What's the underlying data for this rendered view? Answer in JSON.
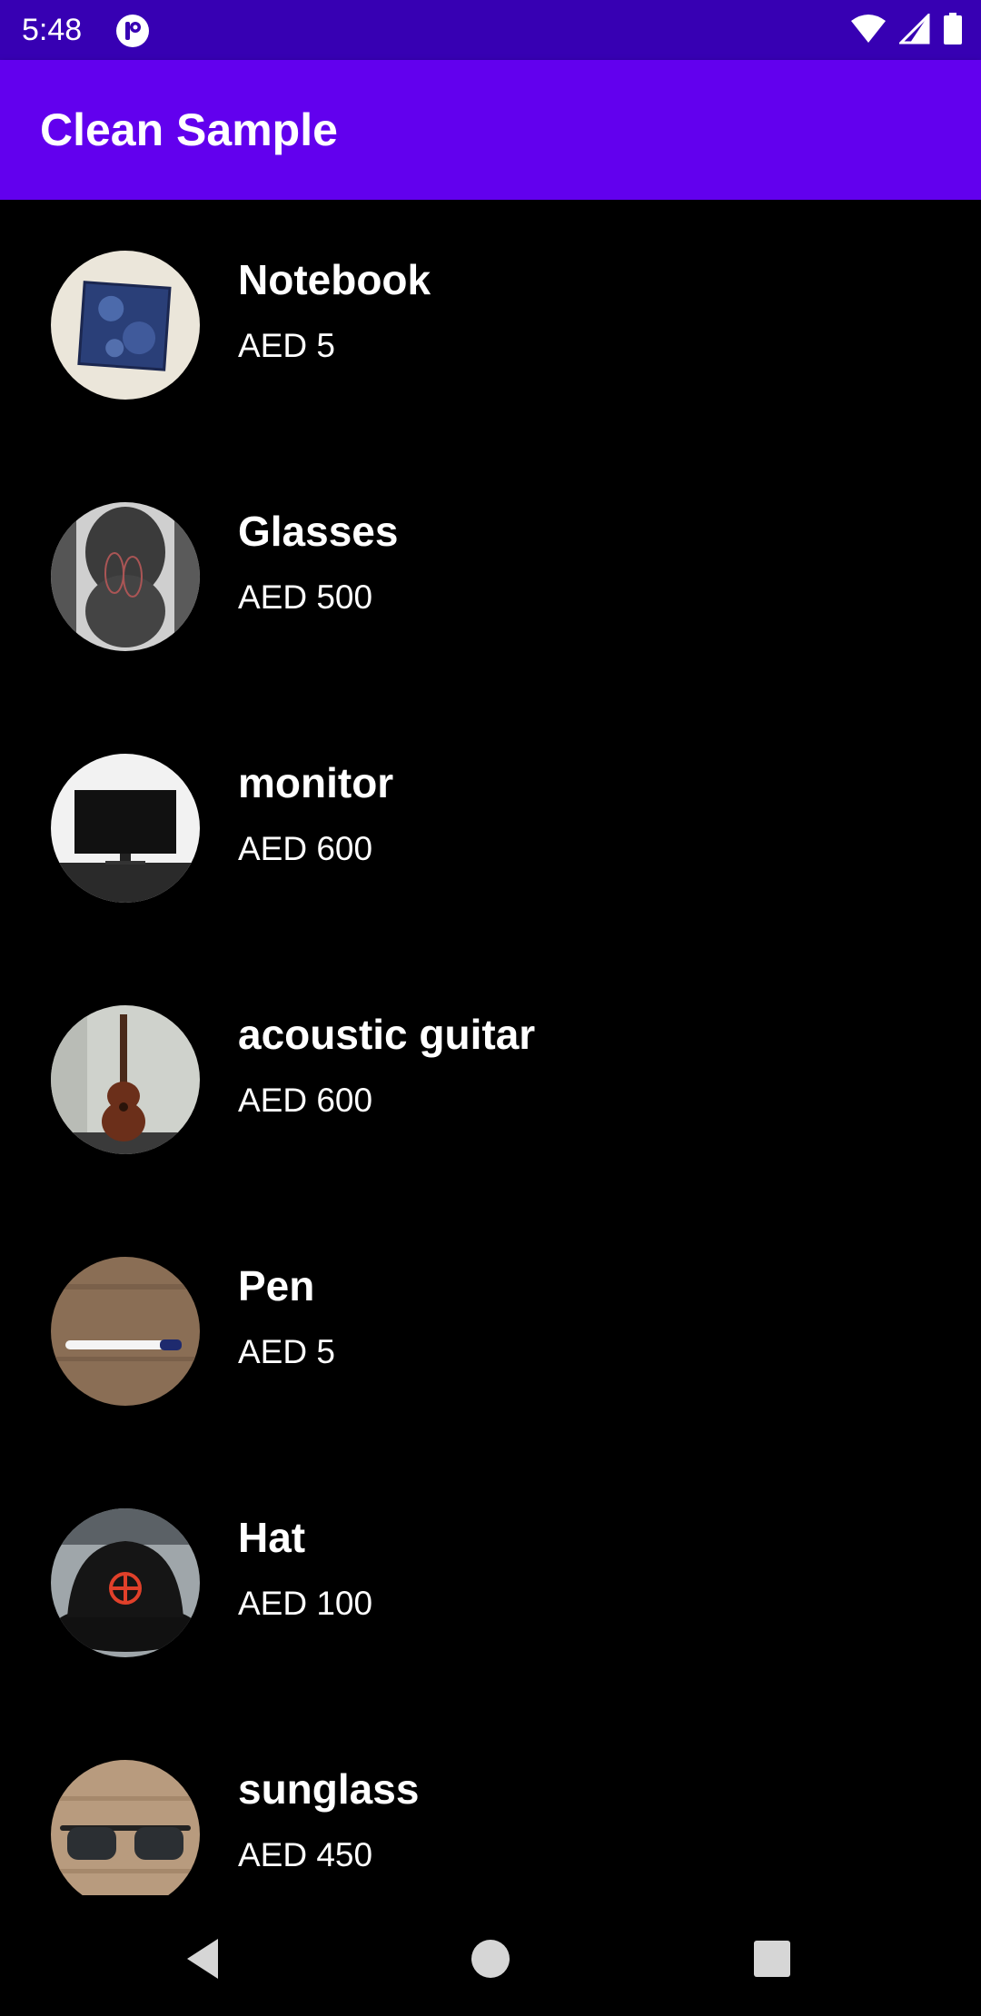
{
  "status_bar": {
    "time": "5:48",
    "icons": [
      "app-notification-icon",
      "wifi-icon",
      "signal-icon",
      "battery-icon"
    ]
  },
  "app_bar": {
    "title": "Clean Sample",
    "color": "#6200ee"
  },
  "products": [
    {
      "name": "Notebook",
      "price": "AED 5",
      "image": "notebook-photo"
    },
    {
      "name": "Glasses",
      "price": "AED 500",
      "image": "glasses-photo"
    },
    {
      "name": "monitor",
      "price": "AED 600",
      "image": "monitor-photo"
    },
    {
      "name": "acoustic guitar",
      "price": "AED 600",
      "image": "guitar-photo"
    },
    {
      "name": "Pen",
      "price": "AED 5",
      "image": "pen-photo"
    },
    {
      "name": "Hat",
      "price": "AED 100",
      "image": "hat-photo"
    },
    {
      "name": "sunglass",
      "price": "AED 450",
      "image": "sunglass-photo"
    }
  ],
  "nav_bar": {
    "buttons": [
      "back-icon",
      "home-icon",
      "recents-icon"
    ]
  }
}
